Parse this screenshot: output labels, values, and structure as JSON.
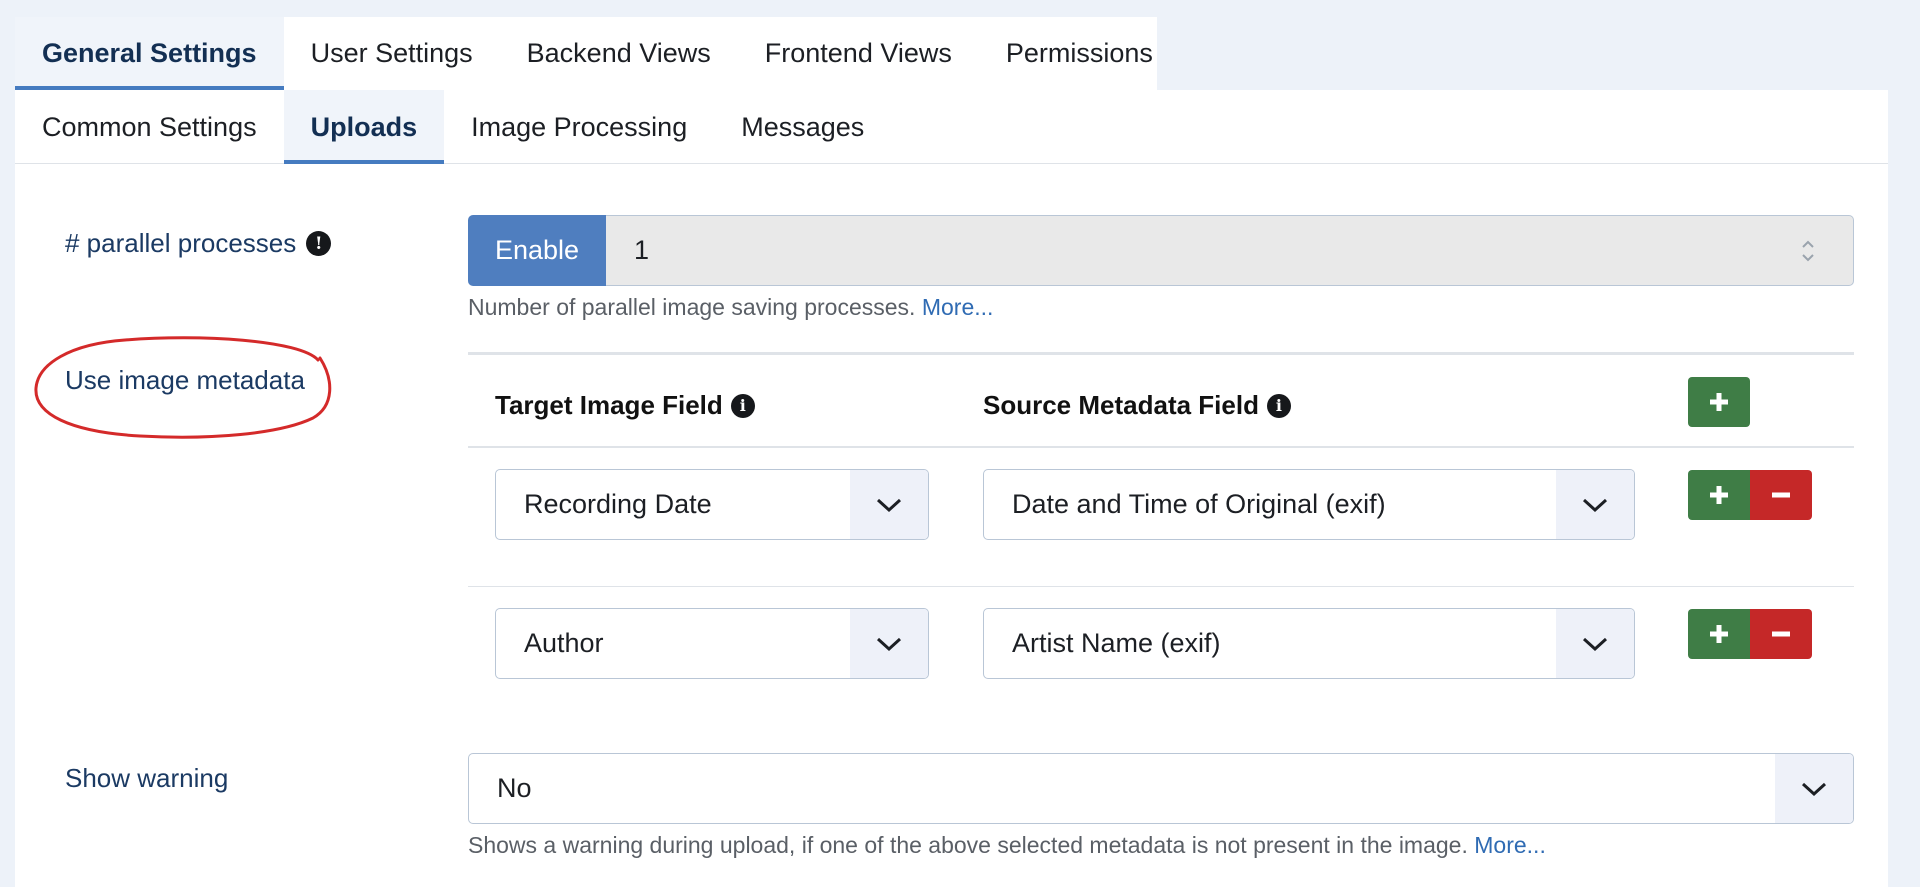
{
  "main_tabs": [
    {
      "label": "General Settings",
      "active": true
    },
    {
      "label": "User Settings",
      "active": false
    },
    {
      "label": "Backend Views",
      "active": false
    },
    {
      "label": "Frontend Views",
      "active": false
    },
    {
      "label": "Permissions",
      "active": false
    }
  ],
  "sub_tabs": [
    {
      "label": "Common Settings",
      "active": false
    },
    {
      "label": "Uploads",
      "active": true
    },
    {
      "label": "Image Processing",
      "active": false
    },
    {
      "label": "Messages",
      "active": false
    }
  ],
  "parallel": {
    "label": "# parallel processes",
    "enable_label": "Enable",
    "value": "1",
    "help": "Number of parallel image saving processes.",
    "more": "More..."
  },
  "metadata": {
    "label": "Use image metadata",
    "col_target": "Target Image Field",
    "col_source": "Source Metadata Field",
    "rows": [
      {
        "target": "Recording Date",
        "source": "Date and Time of Original (exif)"
      },
      {
        "target": "Author",
        "source": "Artist Name (exif)"
      }
    ]
  },
  "warning": {
    "label": "Show warning",
    "value": "No",
    "help": "Shows a warning during upload, if one of the above selected metadata is not present in the image.",
    "more": "More..."
  },
  "colors": {
    "enable": "#4f7ebf",
    "add": "#3f7d46",
    "remove": "#c52828",
    "annotation": "#d42a2a",
    "link": "#2f6bb3"
  },
  "icons": {
    "info": "info-icon",
    "spinner": "up-down-icon",
    "dropdown": "chevron-down-icon",
    "add": "plus-icon",
    "remove": "minus-icon"
  }
}
